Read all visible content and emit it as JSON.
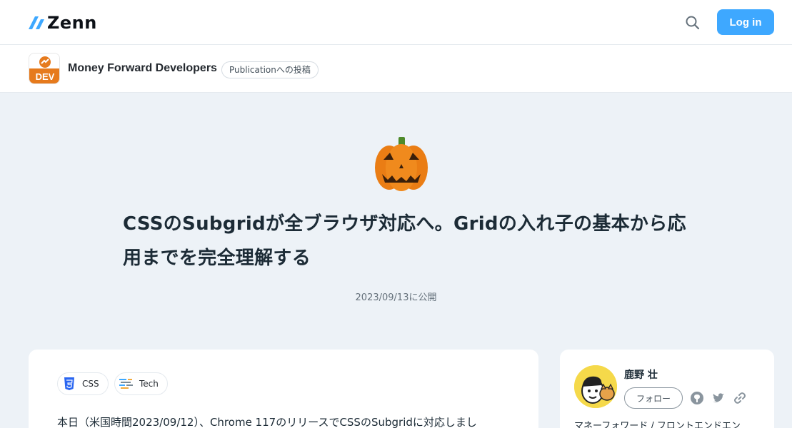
{
  "header": {
    "logo_text": "Zenn",
    "login_label": "Log in",
    "search_icon": "search-icon"
  },
  "publication": {
    "logo_text": "DEV",
    "name": "Money Forward Developers",
    "badge": "Publicationへの投稿"
  },
  "article": {
    "emoji": "jack-o-lantern",
    "title_line1": "CSSのSubgridが全ブラウザ対応へ。Gridの入れ子の基本から応",
    "title_line2": "用までを完全理解する",
    "date": "2023/09/13に公開",
    "topics": [
      {
        "label": "CSS",
        "icon": "css3-icon"
      },
      {
        "label": "Tech",
        "icon": "tech-icon"
      }
    ],
    "body_first_line": "本日（米国時間2023/09/12）、Chrome 117のリリースでCSSのSubgridに対応しまし"
  },
  "author": {
    "name": "鹿野 壮",
    "follow_label": "フォロー",
    "bio": "マネーフォワード / フロントエンドエン"
  },
  "colors": {
    "accent": "#3ea8ff",
    "background": "#edf2f7",
    "pub_orange": "#e67a1c"
  }
}
